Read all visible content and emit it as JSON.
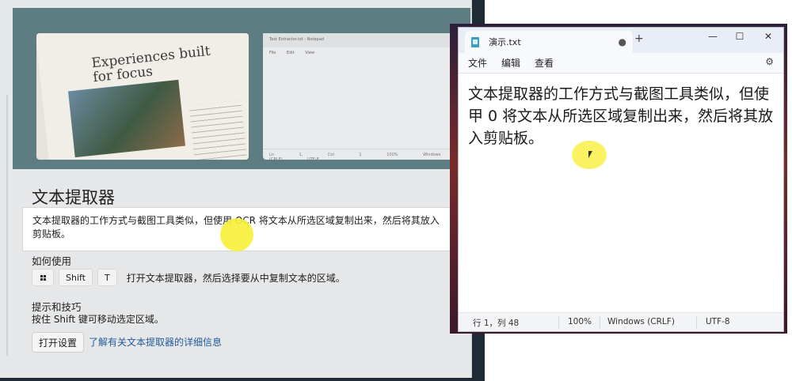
{
  "settings": {
    "hero": {
      "card1_headline": "Experiences built for focus",
      "card2_title": "Text Extractor.txt - Notepad",
      "card2_menu": [
        "File",
        "Edit",
        "View"
      ],
      "card2_status": [
        "Ln 1, Col 1",
        "100%",
        "Windows (CRLF)",
        "UTF-8"
      ]
    },
    "title": "文本提取器",
    "description": "文本提取器的工作方式与截图工具类似，但使用 OCR 将文本从所选区域复制出来，然后将其放入剪贴板。",
    "howto_label": "如何使用",
    "keys": [
      "Shift",
      "T"
    ],
    "keys_description": "打开文本提取器，然后选择要从中复制文本的区域。",
    "tips_label": "提示和技巧",
    "tip_text": "按住 Shift 键可移动选定区域。",
    "open_settings_label": "打开设置",
    "learn_more_link": "了解有关文本提取器的详细信息"
  },
  "notepad": {
    "tab_title": "演示.txt",
    "unsaved_dot": "●",
    "new_tab": "+",
    "controls": {
      "minimize": "—",
      "maximize": "☐",
      "close": "✕"
    },
    "menu": [
      "文件",
      "编辑",
      "查看"
    ],
    "content": "文本提取器的工作方式与截图工具类似，但使甲 0 将文本从所选区域复制出来，然后将其放入剪贴板。",
    "status": {
      "position": "行 1，列 48",
      "zoom": "100%",
      "line_ending": "Windows (CRLF)",
      "encoding": "UTF-8"
    }
  }
}
